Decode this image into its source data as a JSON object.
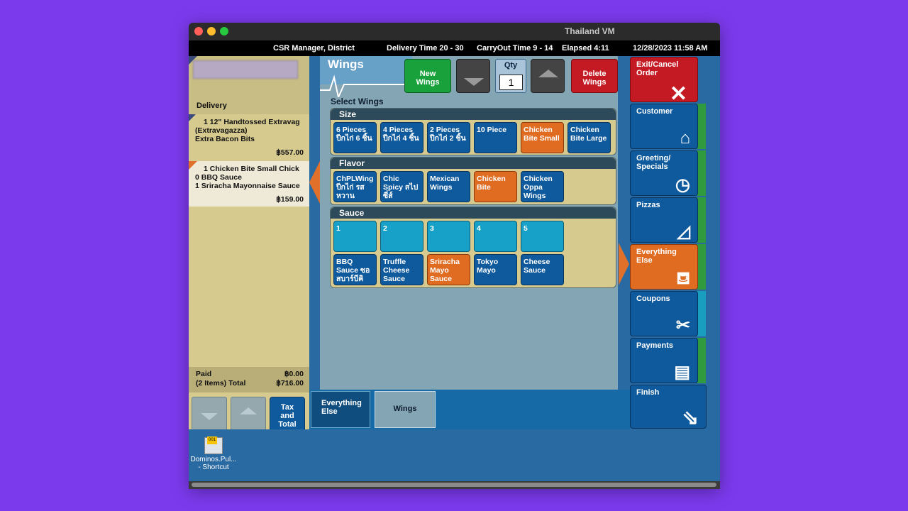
{
  "window": {
    "title": "Thailand VM"
  },
  "status": {
    "user": "CSR Manager, District",
    "delivery_time": "Delivery Time 20 - 30",
    "carryout_time": "CarryOut Time 9 - 14",
    "elapsed": "Elapsed 4:11",
    "datetime": "12/28/2023 11:58 AM"
  },
  "order": {
    "type": "Delivery",
    "items": [
      {
        "line1": "1 12\" Handtossed Extravag",
        "line2": "(Extravagazza)",
        "line3": "Extra Bacon Bits",
        "price": "฿557.00"
      },
      {
        "line1": "1 Chicken Bite Small Chick",
        "line2": "0 BBQ Sauce",
        "line3": "1 Sriracha Mayonnaise Sauce",
        "price": "฿159.00"
      }
    ],
    "paid_label": "Paid",
    "paid_value": "฿0.00",
    "total_label": "(2 Items) Total",
    "total_value": "฿716.00",
    "tax_button": "Tax and Total"
  },
  "main": {
    "title": "Wings",
    "new_button": "New Wings",
    "qty_label": "Qty",
    "qty_value": "1",
    "delete_button": "Delete Wings",
    "select_label": "Select Wings",
    "size_header": "Size",
    "sizes": [
      "6 Pieces ปีกไก่ 6 ชิ้น",
      "4 Pieces ปีกไก่ 4 ชิ้น",
      "2 Pieces ปีกไก่ 2 ชิ้น",
      "10 Piece",
      "Chicken Bite Small",
      "Chicken Bite Large"
    ],
    "flavor_header": "Flavor",
    "flavors": [
      "ChPLWing ปีกไก่ รสหวาน",
      "Chic Spicy สไปซี่ส์",
      "Mexican Wings",
      "Chicken Bite",
      "Chicken Oppa Wings"
    ],
    "sauce_header": "Sauce",
    "sauce_slots": [
      "1",
      "2",
      "3",
      "4",
      "5"
    ],
    "sauces": [
      "BBQ Sauce ซอสบาร์บีคิ",
      "Truffle Cheese Sauce",
      "Sriracha Mayo Sauce",
      "Tokyo Mayo",
      "Cheese Sauce"
    ]
  },
  "tabs": [
    "Everything Else",
    "Wings"
  ],
  "nav": {
    "exit": "Exit/Cancel Order",
    "items": [
      "Customer",
      "Greeting/ Specials",
      "Pizzas",
      "Everything Else",
      "Coupons",
      "Payments",
      "Finish"
    ]
  },
  "desktop": {
    "shortcut": "Dominos.Pul... - Shortcut",
    "icon_badge": "001"
  }
}
